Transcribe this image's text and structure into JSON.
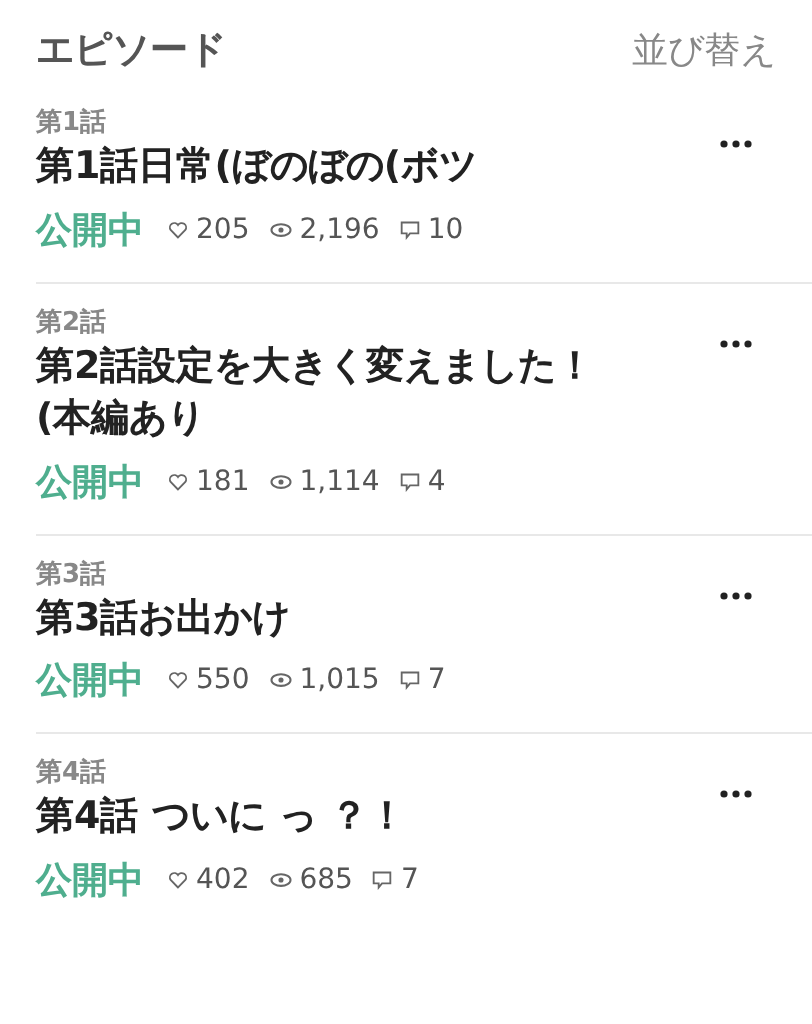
{
  "header": {
    "title": "エピソード",
    "sort_link": "並び替え"
  },
  "episodes": [
    {
      "number": "第1話",
      "title": "第1話日常(ぼのぼの(ボツ",
      "status": "公開中",
      "likes": "205",
      "views": "2,196",
      "comments": "10"
    },
    {
      "number": "第2話",
      "title": "第2話設定を大きく変えました！(本編あり",
      "status": "公開中",
      "likes": "181",
      "views": "1,114",
      "comments": "4"
    },
    {
      "number": "第3話",
      "title": "第3話お出かけ",
      "status": "公開中",
      "likes": "550",
      "views": "1,015",
      "comments": "7"
    },
    {
      "number": "第4話",
      "title": "第4話 ついに っ ？！",
      "status": "公開中",
      "likes": "402",
      "views": "685",
      "comments": "7"
    }
  ]
}
